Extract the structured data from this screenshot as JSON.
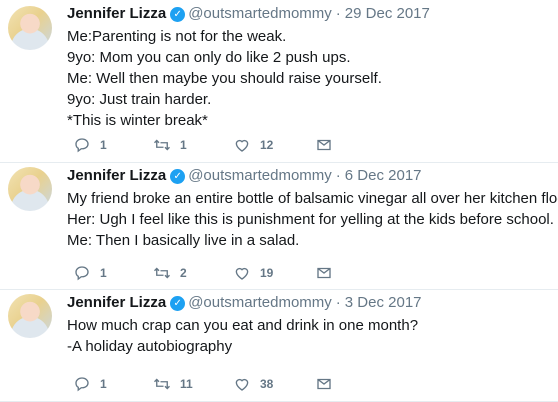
{
  "tweets": [
    {
      "name": "Jennifer Lizza",
      "handle": "@outsmartedmommy",
      "separator": "·",
      "date": "29 Dec 2017",
      "lines": [
        "Me:Parenting is not for the weak.",
        "9yo: Mom you can only do like 2 push ups.",
        "Me: Well then maybe you should raise yourself.",
        "9yo: Just train harder.",
        "*This is winter break*"
      ],
      "replies": "1",
      "retweets": "1",
      "likes": "12"
    },
    {
      "name": "Jennifer Lizza",
      "handle": "@outsmartedmommy",
      "separator": "·",
      "date": "6 Dec 2017",
      "lines": [
        "My friend broke an entire bottle of balsamic vinegar all over her kitchen floor.",
        "Her: Ugh I feel like this is punishment for yelling at the kids before school.",
        "Me: Then I basically live in a salad."
      ],
      "replies": "1",
      "retweets": "2",
      "likes": "19"
    },
    {
      "name": "Jennifer Lizza",
      "handle": "@outsmartedmommy",
      "separator": "·",
      "date": "3 Dec 2017",
      "lines": [
        "How much crap can you eat and drink in one month?",
        "-A holiday autobiography"
      ],
      "replies": "1",
      "retweets": "11",
      "likes": "38"
    }
  ],
  "icons": {
    "reply": "reply-icon",
    "retweet": "retweet-icon",
    "like": "heart-icon",
    "dm": "envelope-icon",
    "verified": "verified-badge-icon"
  },
  "colors": {
    "verified": "#1da1f2",
    "secondary_text": "#657786",
    "divider": "#e6ecf0"
  }
}
